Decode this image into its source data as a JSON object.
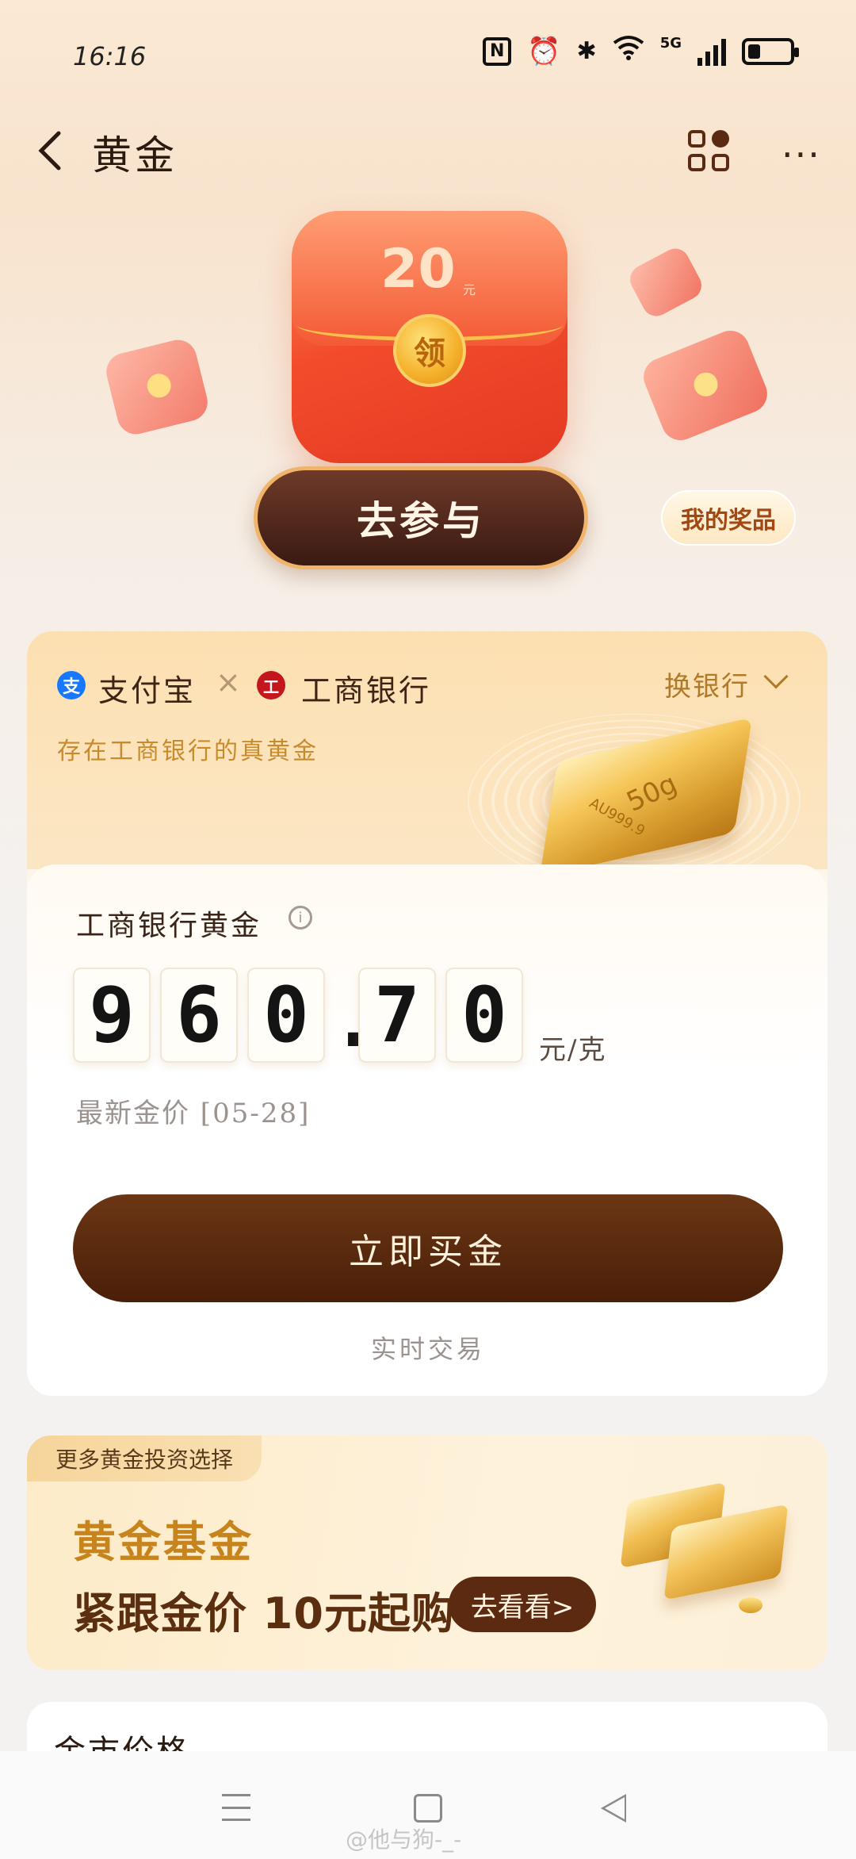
{
  "status_bar": {
    "time": "16:16",
    "icons": [
      "nfc-icon",
      "alarm-icon",
      "bluetooth-icon",
      "wifi-icon",
      "5g-signal-icon",
      "battery-icon"
    ],
    "network": "5G",
    "battery_level": 0.3
  },
  "header": {
    "title": "黄金"
  },
  "banner": {
    "amount": "20",
    "amount_unit": "元",
    "seal_char": "领",
    "join_label": "去参与",
    "my_prizes_label": "我的奖品"
  },
  "bank_card": {
    "alipay": "支付宝",
    "alipay_icon_char": "支",
    "times": "×",
    "bank": "工商银行",
    "bank_icon_char": "工",
    "switch_label": "换银行",
    "subtitle": "存在工商银行的真黄金",
    "bar_weight": "50g",
    "bar_purity": "AU999.9",
    "price_title": "工商银行黄金",
    "price_digits": [
      "9",
      "6",
      "0",
      ".",
      "7",
      "0"
    ],
    "price_unit": "元/克",
    "latest_label": "最新金价 [05-28]",
    "buy_label": "立即买金",
    "realtime_label": "实时交易"
  },
  "fund_card": {
    "tag": "更多黄金投资选择",
    "title": "黄金基金",
    "slogan": "紧跟金价 10元起购",
    "see_label": "去看看>"
  },
  "market_card": {
    "title": "金市价格"
  },
  "watermark": "@他与狗-_-",
  "colors": {
    "accent_brown": "#5c2a10",
    "gold": "#c8841c",
    "red_envelope": "#f24b2c"
  }
}
